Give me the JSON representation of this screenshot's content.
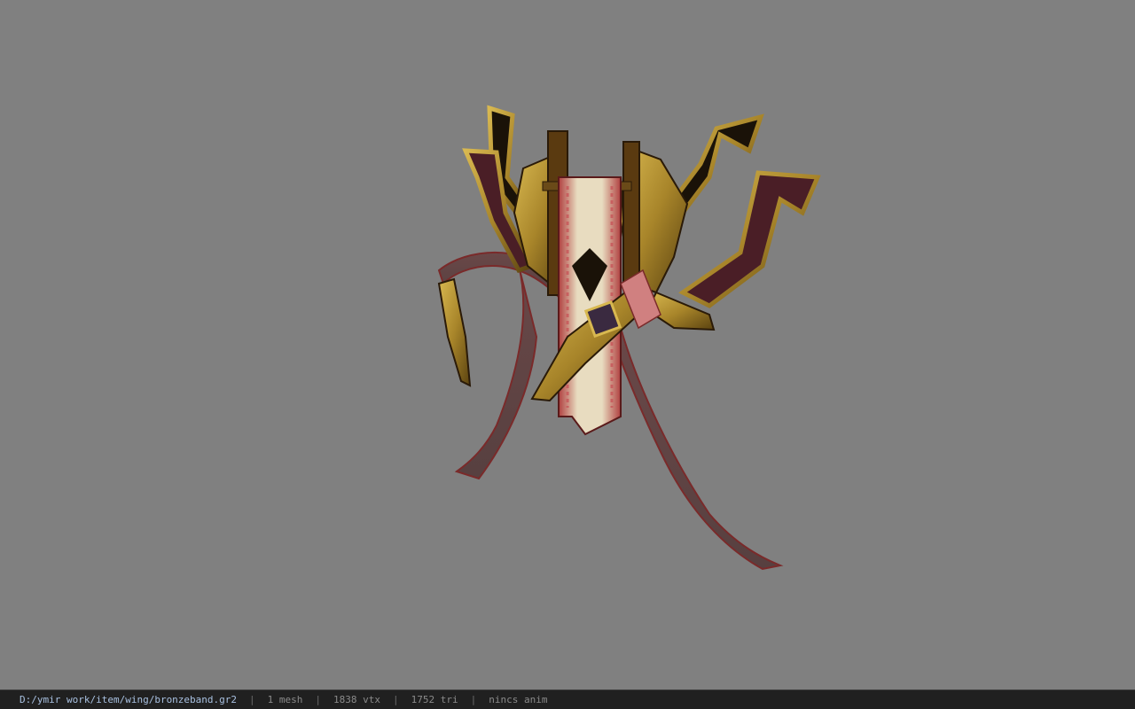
{
  "window": {
    "background": "#808080"
  },
  "viewport": {
    "model_name": "bronzeband",
    "colors": {
      "gold": "#a8852a",
      "gold_dark": "#5a4210",
      "black_lacquer": "#1a1208",
      "maroon": "#4a1e26",
      "ribbon": "#5a4040",
      "ribbon_edge": "#7a2a2a",
      "banner_red": "#9a3030",
      "banner_cream": "#e8dcc0",
      "pink": "#d08080"
    }
  },
  "status": {
    "path": "D:/ymir work/item/wing/bronzeband.gr2",
    "sep": "|",
    "mesh": "1 mesh",
    "vtx": "1838 vtx",
    "tri": "1752 tri",
    "anim": "nincs anim"
  }
}
